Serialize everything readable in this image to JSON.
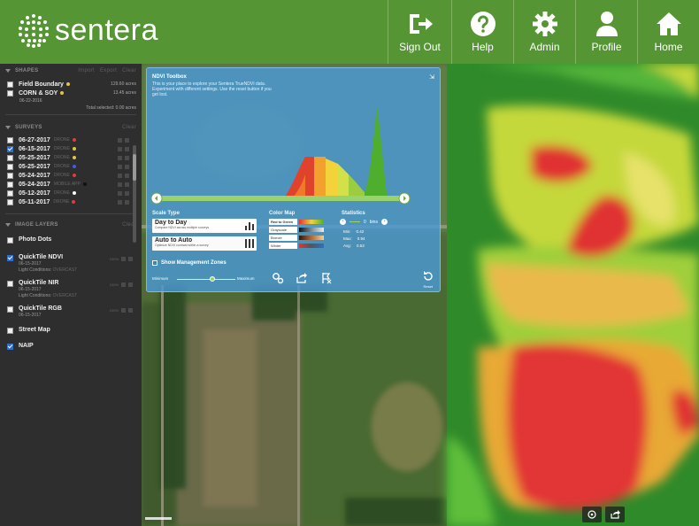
{
  "app": {
    "brand": "sentera",
    "accent": "#559534"
  },
  "nav": [
    {
      "label": "Sign Out",
      "icon": "sign-out-icon"
    },
    {
      "label": "Help",
      "icon": "help-icon"
    },
    {
      "label": "Admin",
      "icon": "gear-icon"
    },
    {
      "label": "Profile",
      "icon": "profile-icon"
    },
    {
      "label": "Home",
      "icon": "home-icon"
    }
  ],
  "sidebar": {
    "shapes": {
      "header": "SHAPES",
      "buttons": [
        "Import",
        "Export",
        "Clear"
      ],
      "items": [
        {
          "label": "Field Boundary",
          "acres": "129.60 acres",
          "color": "#e6c53a"
        },
        {
          "label": "CORN & SOY",
          "date": "06-22-2016",
          "acres": "13.45 acres",
          "color": "#e6c53a"
        }
      ],
      "total": "Total selected: 0.00 acres"
    },
    "surveys": {
      "header": "SURVEYS",
      "button": "Clear",
      "items": [
        {
          "label": "06-27-2017",
          "tag": "DRONE",
          "color": "#e23b3b",
          "checked": false
        },
        {
          "label": "06-15-2017",
          "tag": "DRONE",
          "color": "#e6c53a",
          "checked": true
        },
        {
          "label": "05-25-2017",
          "tag": "DRONE",
          "color": "#e6c53a",
          "checked": false
        },
        {
          "label": "05-25-2017",
          "tag": "DRONE",
          "color": "#3a5fe2",
          "checked": false
        },
        {
          "label": "05-24-2017",
          "tag": "DRONE",
          "color": "#e23b3b",
          "checked": false
        },
        {
          "label": "05-24-2017",
          "tag": "MOBILE APP",
          "color": "#111111",
          "checked": false
        },
        {
          "label": "05-12-2017",
          "tag": "DRONE",
          "color": "#ffffff",
          "checked": false
        },
        {
          "label": "05-11-2017",
          "tag": "DRONE",
          "color": "#e23b3b",
          "checked": false
        }
      ]
    },
    "layers": {
      "header": "IMAGE LAYERS",
      "button": "Clear",
      "items": [
        {
          "label": "Photo Dots",
          "checked": false
        },
        {
          "label": "QuickTile NDVI",
          "date": "06-15-2017",
          "conditions": "Light Conditions:",
          "cond_value": "OVERCAST",
          "pct": "100%",
          "checked": true
        },
        {
          "label": "QuickTile NIR",
          "date": "06-15-2017",
          "conditions": "Light Conditions:",
          "cond_value": "OVERCAST",
          "pct": "100%",
          "checked": false
        },
        {
          "label": "QuickTile RGB",
          "date": "06-15-2017",
          "pct": "100%",
          "checked": false
        },
        {
          "label": "Street Map",
          "checked": false
        },
        {
          "label": "NAIP",
          "checked": true
        }
      ]
    }
  },
  "ndvi": {
    "title": "NDVI Toolbox",
    "description": "This is your place to explore your Sentera TrueNDVI data. Experiment with different settings. Use the reset button if you get lost.",
    "scale": {
      "title": "Scale Type",
      "day_label": "Day to Day",
      "day_desc": "Compare NDVI across multiple surveys",
      "auto_label": "Auto to Auto",
      "auto_desc": "Optimize NDVI contrast within a survey"
    },
    "color_map": {
      "title": "Color Map",
      "items": [
        "Red to Green",
        "Grayscale",
        "Bronze",
        "Winter"
      ]
    },
    "statistics": {
      "title": "Statistics",
      "count": "0",
      "unit": "bins",
      "rows": [
        {
          "label": "Min:",
          "value": "0.42"
        },
        {
          "label": "Max:",
          "value": "0.94"
        },
        {
          "label": "Avg:",
          "value": "0.53"
        }
      ]
    },
    "zones_label": "Show Management Zones",
    "min_label": "Minimum",
    "max_label": "Maximum",
    "slider_level": 0.6,
    "reset_label": "Reset"
  }
}
